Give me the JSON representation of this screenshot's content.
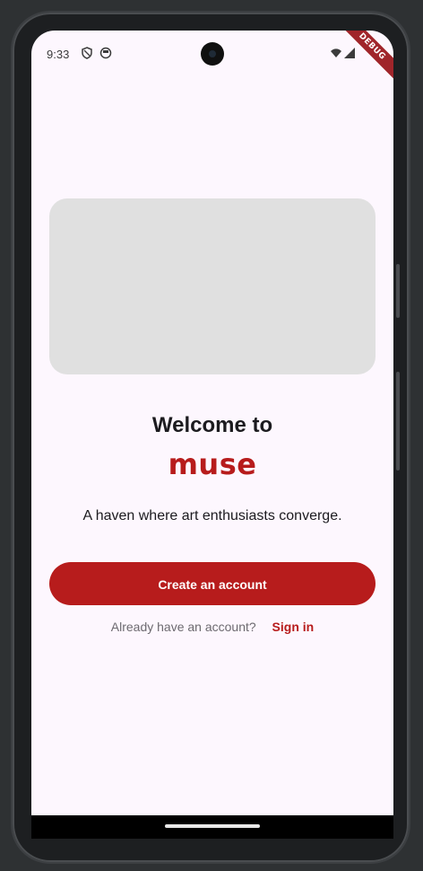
{
  "status_bar": {
    "time": "9:33",
    "icons": [
      "shield-icon",
      "face-icon",
      "wifi-icon",
      "signal-icon"
    ]
  },
  "debug_banner": "DEBUG",
  "welcome": {
    "title": "Welcome to",
    "brand": "muse",
    "tagline": "A haven where art enthusiasts converge."
  },
  "actions": {
    "create_account": "Create an account",
    "signin_prompt": "Already have an account?",
    "signin_link": "Sign in"
  },
  "colors": {
    "brand": "#b71c1c",
    "background": "#fdf7fe",
    "placeholder": "#e0e0e0"
  }
}
